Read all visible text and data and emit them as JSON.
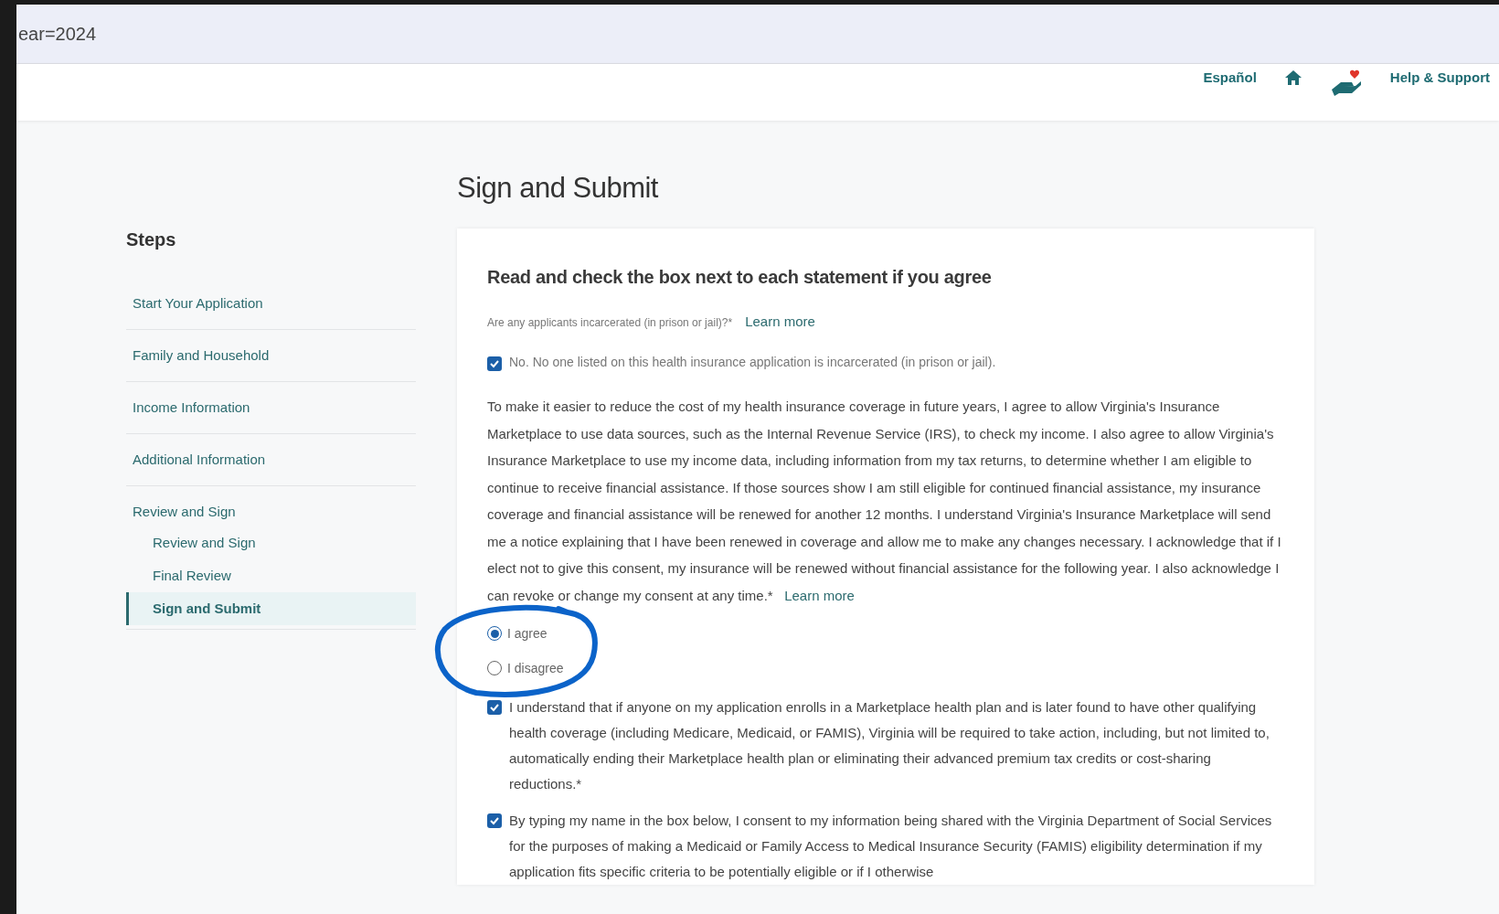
{
  "browser": {
    "address": "ear=2024"
  },
  "header": {
    "links": [
      {
        "kind": "text",
        "label": "Español"
      },
      {
        "kind": "home"
      },
      {
        "kind": "helping-hand"
      },
      {
        "kind": "text",
        "label": "Help & Support"
      }
    ]
  },
  "sidebar": {
    "title": "Steps",
    "items": [
      {
        "label": "Start Your Application",
        "selected": false
      },
      {
        "label": "Family and Household",
        "selected": false
      },
      {
        "label": "Income Information",
        "selected": false
      },
      {
        "label": "Additional Information",
        "selected": false
      },
      {
        "label": "Review and Sign",
        "selected": false,
        "children": [
          {
            "label": "Review and Sign",
            "selected": false
          },
          {
            "label": "Final Review",
            "selected": false
          },
          {
            "label": "Sign and Submit",
            "selected": true
          }
        ]
      }
    ]
  },
  "page_title": "Sign and Submit",
  "card": {
    "heading": "Read and check the box next to each statement if you agree",
    "question": {
      "label": "Are any applicants incarcerated (in prison or jail)?*",
      "link": "Learn more"
    },
    "incarceration": {
      "label": "No. No one listed on this health insurance application is incarcerated (in prison or jail).",
      "checked": true
    },
    "consent": {
      "text": "To make it easier to reduce the cost of my health insurance coverage in future years, I agree to allow Virginia's Insurance Marketplace to use data sources, such as the Internal Revenue Service (IRS), to check my income. I also agree to allow Virginia's Insurance Marketplace to use my income data, including information from my tax returns, to determine whether I am eligible to continue to receive financial assistance. If those sources show I am still eligible for continued financial assistance, my insurance coverage and financial assistance will be renewed for another 12 months. I understand Virginia's Insurance Marketplace will send me a notice explaining that I have been renewed in coverage and allow me to make any changes necessary. I acknowledge that if I elect not to give this consent, my insurance will be renewed without financial assistance for the following year. I also acknowledge I can revoke or change my consent at any time.*",
      "link": "Learn more",
      "options": [
        {
          "label": "I agree",
          "selected": true
        },
        {
          "label": "I disagree",
          "selected": false
        }
      ]
    },
    "statements": [
      {
        "text": "I understand that if anyone on my application enrolls in a Marketplace health plan and is later found to have other qualifying health coverage (including Medicare, Medicaid, or FAMIS), Virginia will be required to take action, including, but not limited to, automatically ending their Marketplace health plan or eliminating their advanced premium tax credits or cost-sharing reductions.*",
        "checked": true
      },
      {
        "text": "By typing my name in the box below, I consent to my information being shared with the Virginia Department of Social Services for the purposes of making a Medicaid or Family Access to Medical Insurance Security (FAMIS) eligibility determination if my application fits specific criteria to be potentially eligible or if I otherwise",
        "checked": true
      }
    ]
  }
}
